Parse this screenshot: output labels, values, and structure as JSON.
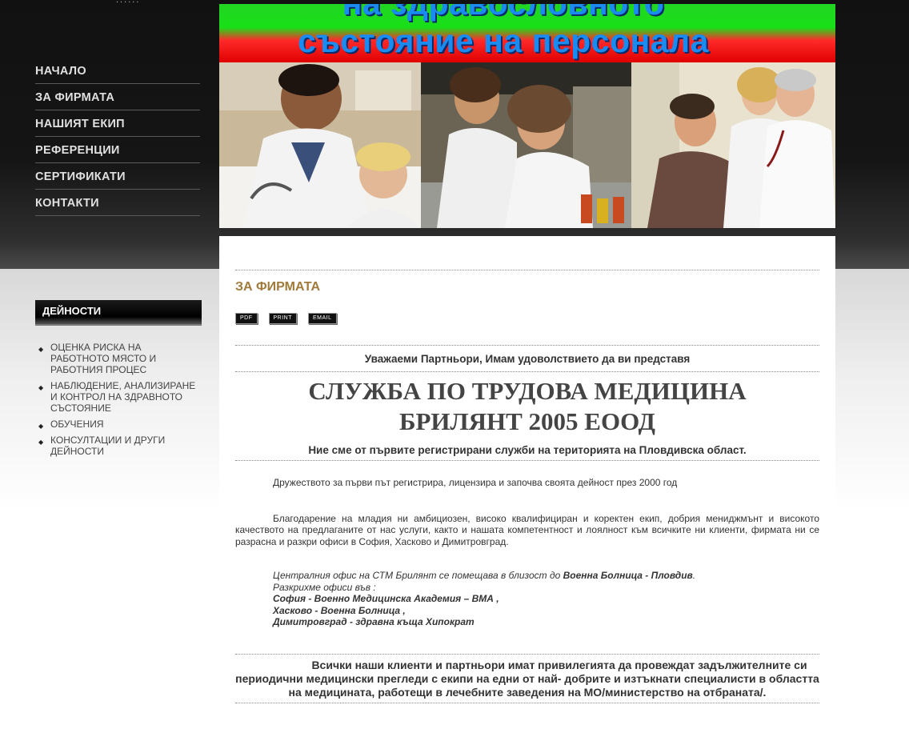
{
  "header": {
    "tagline": "......",
    "banner_line1": "на здравословното",
    "banner_line2": "състояние на персонала"
  },
  "nav": {
    "items": [
      {
        "label": "НАЧАЛО"
      },
      {
        "label": "ЗА ФИРМАТА"
      },
      {
        "label": "НАШИЯТ ЕКИП"
      },
      {
        "label": "РЕФЕРЕНЦИИ"
      },
      {
        "label": "СЕРТИФИКАТИ"
      },
      {
        "label": "КОНТАКТИ"
      }
    ]
  },
  "sidebar": {
    "title": "ДЕЙНОСТИ",
    "items": [
      {
        "label": "ОЦЕНКА РИСКА НА РАБОТНОТО МЯСТО И РАБОТНИЯ ПРОЦЕС"
      },
      {
        "label": "НАБЛЮДЕНИЕ, АНАЛИЗИРАНЕ И КОНТРОЛ НА ЗДРАВНОТО СЪСТОЯНИЕ"
      },
      {
        "label": "ОБУЧЕНИЯ"
      },
      {
        "label": "КОНСУЛТАЦИИ И ДРУГИ ДЕЙНОСТИ"
      }
    ]
  },
  "article": {
    "title": "ЗА ФИРМАТА",
    "icons": {
      "pdf": "PDF",
      "print": "PRINT",
      "email": "EMAIL"
    },
    "greeting": "Уважаеми Партньори, Имам удоволствието да ви представя",
    "company_line1": "СЛУЖБА ПО ТРУДОВА МЕДИЦИНА",
    "company_line2": "БРИЛЯНТ 2005 ЕООД",
    "subtitle": "Ние сме от първите регистрирани служби на територията на Пловдивска област.",
    "para1": "Дружеството за първи път регистрира, лицензира и започва своята дейност през 2000 год",
    "para2": "Благодарение на младия ни амбициозен, високо квалифициран и коректен екип, добрия мениджмънт и високото качеството на предлаганите от нас услуги, както и нашата компетентност и лоялност към всичките ни клиенти, фирмата ни се разрасна и разкри офиси в София, Хасково и Димитровград.",
    "office_intro": "Централния офис на СТМ Брилянт се помещава в близост до ",
    "office_hq": "Военна Болница - Пловдив",
    "office_dot": ".",
    "office_more": "Разкрихме офиси във :",
    "office_sofia": "София - Военно Медицинска Академия – ВМА ,",
    "office_haskovo": "Хасково - Военна Болница  ,",
    "office_dimitrovgrad": "Димитровград - здравна къща Хипократ",
    "closing": "Всички наши клиенти и партньори имат привилегията да провеждат задължителните си периодични медицински прегледи с екипи на едни от най- добрите и изтъкнати специалисти в областта на медицината, работещи в лечебните заведения на МО/министерство на отбраната/."
  },
  "colors": {
    "title_accent": "#a07a3a",
    "banner_green": "#22d522",
    "banner_red": "#e00000",
    "banner_text": "#1a8bf0"
  }
}
